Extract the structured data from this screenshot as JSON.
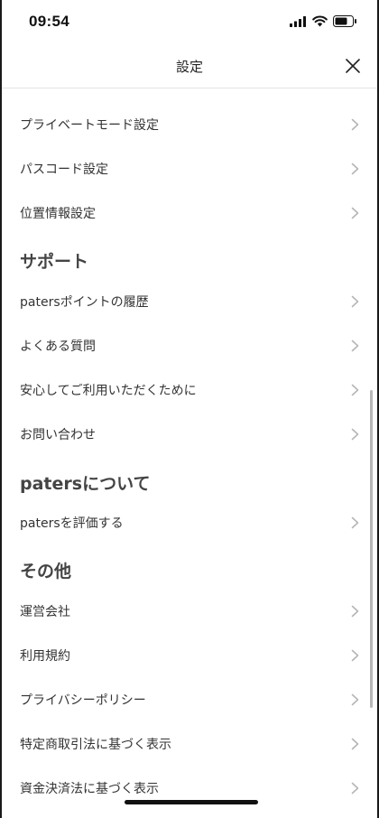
{
  "status": {
    "time": "09:54"
  },
  "nav": {
    "title": "設定",
    "close_icon": "close-icon"
  },
  "items": [
    {
      "label": "プライベートモード設定"
    },
    {
      "label": "パスコード設定"
    },
    {
      "label": "位置情報設定"
    }
  ],
  "sections": [
    {
      "title": "サポート",
      "items": [
        {
          "label": "patersポイントの履歴"
        },
        {
          "label": "よくある質問"
        },
        {
          "label": "安心してご利用いただくために"
        },
        {
          "label": "お問い合わせ"
        }
      ]
    },
    {
      "title": "patersについて",
      "items": [
        {
          "label": "patersを評価する"
        }
      ]
    },
    {
      "title": "その他",
      "items": [
        {
          "label": "運営会社"
        },
        {
          "label": "利用規約"
        },
        {
          "label": "プライバシーポリシー"
        },
        {
          "label": "特定商取引法に基づく表示"
        },
        {
          "label": "資金決済法に基づく表示"
        }
      ]
    }
  ],
  "colors": {
    "chevron": "#b5b5b5",
    "text": "#333333",
    "section_title": "#444444",
    "divider": "#e3e3e3"
  }
}
